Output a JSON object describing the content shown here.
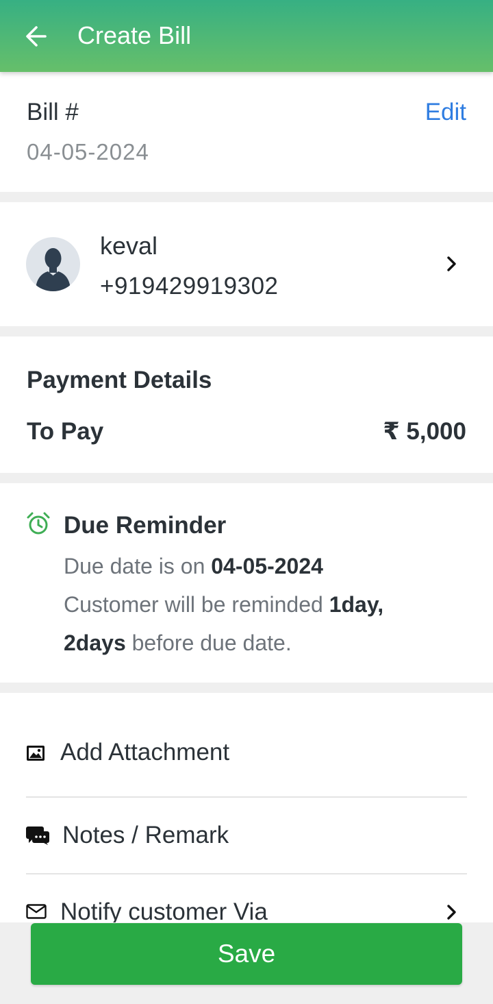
{
  "header": {
    "title": "Create Bill",
    "back_icon": "arrow-left-icon"
  },
  "bill": {
    "label": "Bill #",
    "date": "04-05-2024",
    "edit_label": "Edit"
  },
  "customer": {
    "name": "keval",
    "phone": "+919429919302",
    "avatar_icon": "user-silhouette-icon",
    "chevron_icon": "chevron-right-icon"
  },
  "payment": {
    "heading": "Payment Details",
    "to_pay_label": "To Pay",
    "amount": "₹ 5,000"
  },
  "due_reminder": {
    "heading": "Due Reminder",
    "icon": "alarm-clock-icon",
    "line1_prefix": "Due date is on ",
    "due_date": "04-05-2024",
    "line2_prefix": "Customer will be reminded ",
    "days_part1": "1day,",
    "days_part2": "2days",
    "line3_suffix": " before due date."
  },
  "options": [
    {
      "label": "Add Attachment",
      "icon": "image-icon"
    },
    {
      "label": "Notes / Remark",
      "icon": "chat-bubbles-icon"
    },
    {
      "label": "Notify customer Via",
      "icon": "envelope-icon"
    }
  ],
  "actions": {
    "save_label": "Save"
  },
  "colors": {
    "header_start": "#37b083",
    "header_end": "#66bf6a",
    "accent_blue": "#2f7de1",
    "save_green": "#29aa45",
    "alarm_green": "#3fae55"
  }
}
